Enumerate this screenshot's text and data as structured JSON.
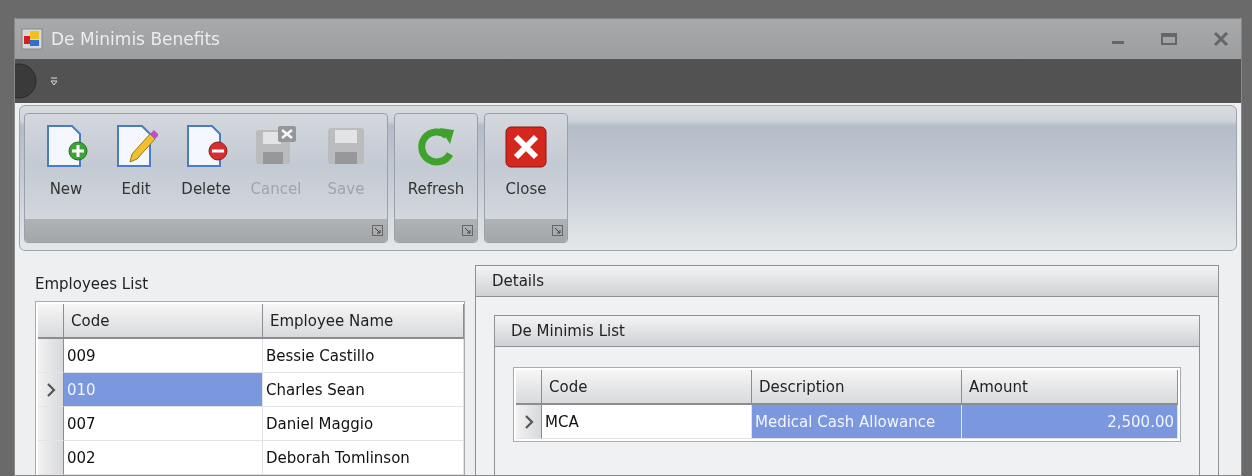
{
  "window": {
    "title": "De Minimis Benefits"
  },
  "ribbon": {
    "groups": [
      {
        "buttons": [
          {
            "label": "New",
            "kind": "new",
            "disabled": false
          },
          {
            "label": "Edit",
            "kind": "edit",
            "disabled": false
          },
          {
            "label": "Delete",
            "kind": "delete",
            "disabled": false
          },
          {
            "label": "Cancel",
            "kind": "cancel",
            "disabled": true
          },
          {
            "label": "Save",
            "kind": "save",
            "disabled": true
          }
        ]
      },
      {
        "buttons": [
          {
            "label": "Refresh",
            "kind": "refresh",
            "disabled": false
          }
        ]
      },
      {
        "buttons": [
          {
            "label": "Close",
            "kind": "close",
            "disabled": false
          }
        ]
      }
    ]
  },
  "employees": {
    "title": "Employees List",
    "columns": [
      "Code",
      "Employee Name"
    ],
    "rows": [
      {
        "selected": false,
        "cells": [
          {
            "text": "009",
            "selected": false
          },
          {
            "text": "Bessie Castillo",
            "selected": false
          }
        ]
      },
      {
        "selected": true,
        "cells": [
          {
            "text": "010",
            "selected": true
          },
          {
            "text": "Charles Sean",
            "selected": false
          }
        ]
      },
      {
        "selected": false,
        "cells": [
          {
            "text": "007",
            "selected": false
          },
          {
            "text": "Daniel Maggio",
            "selected": false
          }
        ]
      },
      {
        "selected": false,
        "cells": [
          {
            "text": "002",
            "selected": false
          },
          {
            "text": "Deborah Tomlinson",
            "selected": false
          }
        ]
      }
    ]
  },
  "details": {
    "title": "Details",
    "de_minimis": {
      "title": "De Minimis List",
      "columns": [
        "Code",
        "Description",
        "Amount"
      ],
      "rows": [
        {
          "selected": true,
          "cells": [
            {
              "text": "MCA",
              "selected": false
            },
            {
              "text": "Medical Cash Allowance",
              "selected": true
            },
            {
              "text": "2,500.00",
              "selected": true
            }
          ]
        }
      ]
    }
  }
}
